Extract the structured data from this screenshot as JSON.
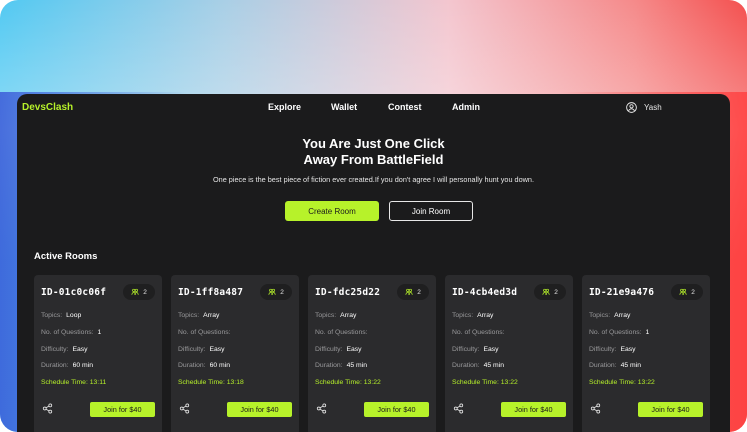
{
  "brand": {
    "logo": "DevsClash"
  },
  "nav": {
    "items": [
      "Explore",
      "Wallet",
      "Contest",
      "Admin"
    ]
  },
  "user": {
    "name": "Yash"
  },
  "hero": {
    "title_line1": "You Are Just One Click",
    "title_line2": "Away From BattleField",
    "subtitle": "One piece is the best piece of fiction ever created.If you don't agree I will personally hunt you down.",
    "create_label": "Create Room",
    "join_label": "Join Room"
  },
  "rooms_section": {
    "title": "Active Rooms"
  },
  "labels": {
    "topics": "Topics:",
    "questions": "No. of Questions:",
    "difficulty": "Difficulty:",
    "duration": "Duration:",
    "schedule": "Schedule Time:"
  },
  "rooms": [
    {
      "id": "ID-01c0c06f",
      "players": "2",
      "topics": "Loop",
      "questions": "1",
      "difficulty": "Easy",
      "duration": "60 min",
      "schedule": "13:11",
      "join": "Join for $40"
    },
    {
      "id": "ID-1ff8a487",
      "players": "2",
      "topics": "Array",
      "questions": "",
      "difficulty": "Easy",
      "duration": "60 min",
      "schedule": "13:18",
      "join": "Join for $40"
    },
    {
      "id": "ID-fdc25d22",
      "players": "2",
      "topics": "Array",
      "questions": "",
      "difficulty": "Easy",
      "duration": "45 min",
      "schedule": "13:22",
      "join": "Join for $40"
    },
    {
      "id": "ID-4cb4ed3d",
      "players": "2",
      "topics": "Array",
      "questions": "",
      "difficulty": "Easy",
      "duration": "45 min",
      "schedule": "13:22",
      "join": "Join for $40"
    },
    {
      "id": "ID-21e9a476",
      "players": "2",
      "topics": "Array",
      "questions": "1",
      "difficulty": "Easy",
      "duration": "45 min",
      "schedule": "13:22",
      "join": "Join for $40"
    }
  ],
  "colors": {
    "accent": "#b7f22a",
    "panel": "#1b1b1c",
    "card": "#2b2b2d"
  }
}
